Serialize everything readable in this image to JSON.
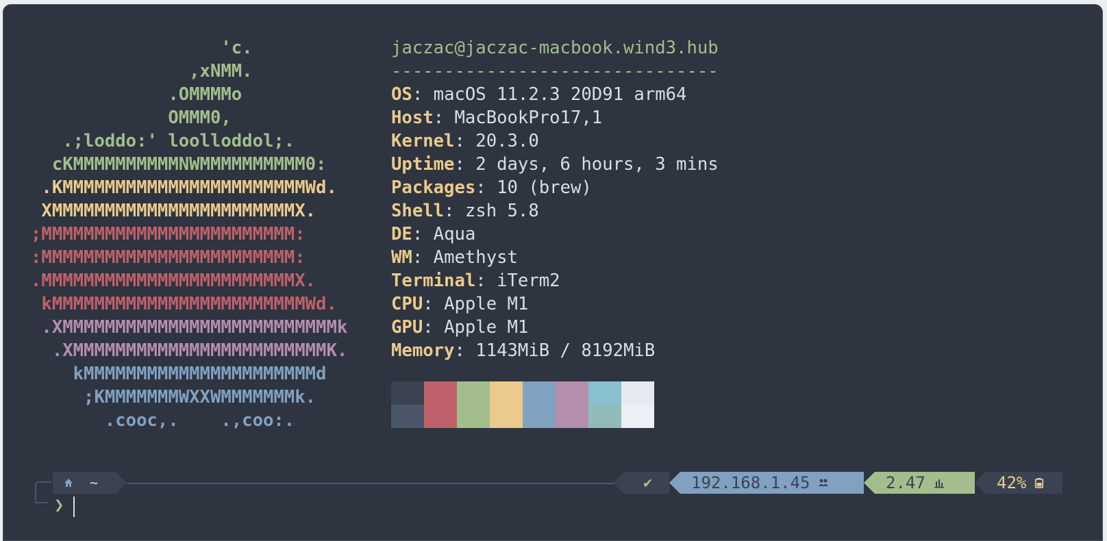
{
  "ascii_lines": [
    {
      "text": "                  'c.",
      "color": "#a3be8c"
    },
    {
      "text": "               ,xNMM.",
      "color": "#a3be8c"
    },
    {
      "text": "             .OMMMMo",
      "color": "#a3be8c"
    },
    {
      "text": "             OMMM0,",
      "color": "#a3be8c"
    },
    {
      "text": "   .;loddo:' loolloddol;.",
      "color": "#a3be8c"
    },
    {
      "text": "  cKMMMMMMMMMMNWMMMMMMMMMM0:",
      "color": "#a3be8c"
    },
    {
      "text": " .KMMMMMMMMMMMMMMMMMMMMMMMWd.",
      "color": "#ebcb8b"
    },
    {
      "text": " XMMMMMMMMMMMMMMMMMMMMMMMX.",
      "color": "#ebcb8b"
    },
    {
      "text": ";MMMMMMMMMMMMMMMMMMMMMMMM:",
      "color": "#bf616a"
    },
    {
      "text": ":MMMMMMMMMMMMMMMMMMMMMMMM:",
      "color": "#bf616a"
    },
    {
      "text": ".MMMMMMMMMMMMMMMMMMMMMMMMX.",
      "color": "#bf616a"
    },
    {
      "text": " kMMMMMMMMMMMMMMMMMMMMMMMMWd.",
      "color": "#bf616a"
    },
    {
      "text": " .XMMMMMMMMMMMMMMMMMMMMMMMMMMk",
      "color": "#b48ead"
    },
    {
      "text": "  .XMMMMMMMMMMMMMMMMMMMMMMMMK.",
      "color": "#b48ead"
    },
    {
      "text": "    kMMMMMMMMMMMMMMMMMMMMMMd",
      "color": "#81a1c1"
    },
    {
      "text": "     ;KMMMMMMMWXXWMMMMMMMk.",
      "color": "#81a1c1"
    },
    {
      "text": "       .cooc,.    .,coo:.",
      "color": "#81a1c1"
    }
  ],
  "user_host": "jaczac@jaczac-macbook.wind3.hub",
  "separator": "-------------------------------",
  "info": [
    {
      "key": "OS",
      "value": " macOS 11.2.3 20D91 arm64"
    },
    {
      "key": "Host",
      "value": " MacBookPro17,1"
    },
    {
      "key": "Kernel",
      "value": " 20.3.0"
    },
    {
      "key": "Uptime",
      "value": " 2 days, 6 hours, 3 mins"
    },
    {
      "key": "Packages",
      "value": " 10 (brew)"
    },
    {
      "key": "Shell",
      "value": " zsh 5.8"
    },
    {
      "key": "DE",
      "value": " Aqua"
    },
    {
      "key": "WM",
      "value": " Amethyst"
    },
    {
      "key": "Terminal",
      "value": " iTerm2"
    },
    {
      "key": "CPU",
      "value": " Apple M1"
    },
    {
      "key": "GPU",
      "value": " Apple M1"
    },
    {
      "key": "Memory",
      "value": " 1143MiB / 8192MiB"
    }
  ],
  "palette_top": [
    "#3b4252",
    "#bf616a",
    "#a3be8c",
    "#ebcb8b",
    "#81a1c1",
    "#b48ead",
    "#88c0d0",
    "#e5e9f0"
  ],
  "palette_bottom": [
    "#4c566a",
    "#bf616a",
    "#a3be8c",
    "#ebcb8b",
    "#81a1c1",
    "#b48ead",
    "#8fbcbb",
    "#eceff4"
  ],
  "prompt": {
    "path": "~",
    "status_check": "✔",
    "ip": "192.168.1.45",
    "load": "2.47",
    "battery": "42%",
    "caret": "❯"
  }
}
